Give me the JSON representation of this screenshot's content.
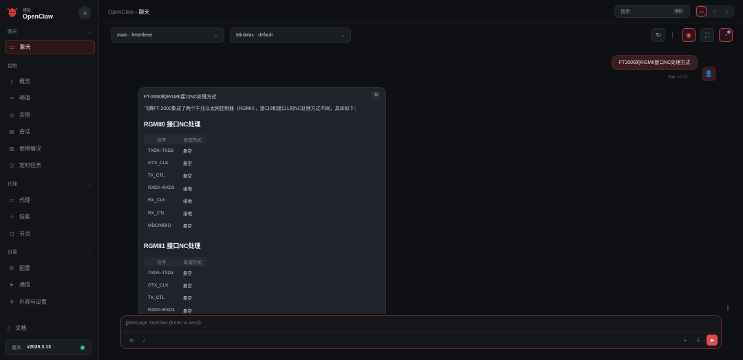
{
  "app": {
    "brand_sub": "模板",
    "brand_name": "OpenClaw",
    "collapse_icon": "menu-icon"
  },
  "sidebar": {
    "sections": [
      {
        "label": "聊天",
        "items": [
          {
            "label": "聊天",
            "icon": "chat-icon",
            "active": true
          }
        ]
      },
      {
        "label": "控制",
        "items": [
          {
            "label": "概览",
            "icon": "chart-icon"
          },
          {
            "label": "频道",
            "icon": "link-icon"
          },
          {
            "label": "实例",
            "icon": "radio-icon"
          },
          {
            "label": "会话",
            "icon": "document-icon"
          },
          {
            "label": "使用情况",
            "icon": "bar-chart-icon"
          },
          {
            "label": "定时任务",
            "icon": "clock-icon"
          }
        ]
      },
      {
        "label": "代理",
        "items": [
          {
            "label": "代理",
            "icon": "folder-icon"
          },
          {
            "label": "技能",
            "icon": "sparkle-icon"
          },
          {
            "label": "节点",
            "icon": "node-icon"
          }
        ]
      },
      {
        "label": "设置",
        "items": [
          {
            "label": "配置",
            "icon": "gear-icon"
          },
          {
            "label": "通信",
            "icon": "send-icon"
          },
          {
            "label": "外观与设置",
            "icon": "palette-icon"
          }
        ]
      }
    ],
    "docs_label": "文档",
    "version_label": "版本",
    "version_value": "v2026.3.13",
    "status_color": "#2ecc71"
  },
  "topbar": {
    "breadcrumb_root": "OpenClaw",
    "breadcrumb_sep": "›",
    "breadcrumb_current": "聊天",
    "search_placeholder": "搜索",
    "search_shortcut": "⌘K"
  },
  "controls": {
    "session_select": "main · heartbeat",
    "model_select": "MiniMax · default"
  },
  "user_message": {
    "text": "FT2000的RGMII接口NC处理方式",
    "author": "You",
    "time": "10:27"
  },
  "assistant": {
    "title": "FT-2000的RGMII接口NC处理方式",
    "intro": "飞腾FT-2000集成了两个千兆以太网控制器（RGMII），接口0和接口1的NC处理方式不同，具体如下：",
    "sections": [
      {
        "heading": "RGMII0 接口NC处理",
        "columns": [
          "信号",
          "处理方式"
        ],
        "rows": [
          [
            "TXD0~TXD3",
            "悬空"
          ],
          [
            "GTX_CLK",
            "悬空"
          ],
          [
            "TX_CTL",
            "悬空"
          ],
          [
            "RXD0~RXD3",
            "接地"
          ],
          [
            "RX_CLK",
            "接地"
          ],
          [
            "RX_CTL",
            "接地"
          ],
          [
            "MDC/MDIO",
            "悬空"
          ]
        ]
      },
      {
        "heading": "RGMII1 接口NC处理",
        "columns": [
          "信号",
          "处理方式"
        ],
        "rows": [
          [
            "TXD0~TXD3",
            "悬空"
          ],
          [
            "GTX_CLK",
            "悬空"
          ],
          [
            "TX_CTL",
            "悬空"
          ],
          [
            "RXD0~RXD3",
            "悬空"
          ]
        ]
      }
    ]
  },
  "composer": {
    "placeholder": "Message YanClaw (Enter to send)"
  },
  "colors": {
    "accent": "#e04b52",
    "background": "#0e1014",
    "sidebar": "#121418"
  }
}
